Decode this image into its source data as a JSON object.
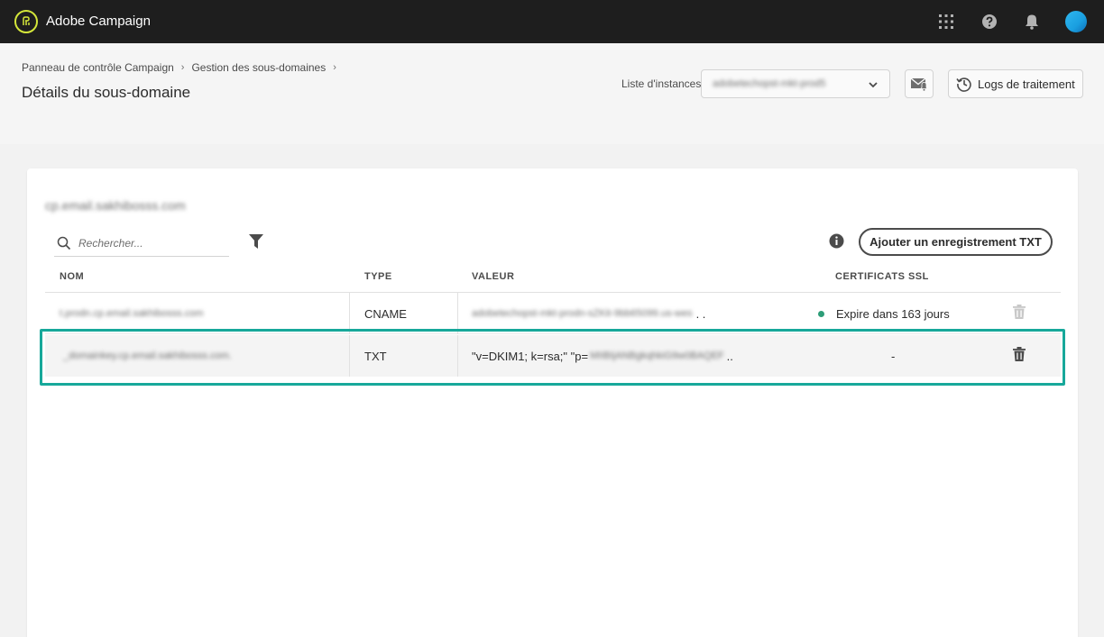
{
  "app": {
    "title": "Adobe Campaign"
  },
  "topbar": {
    "icons": [
      "apps-grid-icon",
      "help-icon",
      "bell-icon",
      "user-avatar"
    ]
  },
  "breadcrumb": {
    "items": [
      "Panneau de contrôle Campaign",
      "Gestion des sous-domaines"
    ]
  },
  "page": {
    "title": "Détails du sous-domaine"
  },
  "instances": {
    "label": "Liste d'instances",
    "selected": "adobetechopst-mkt-prod5"
  },
  "toolbar": {
    "logs_label": "Logs de traitement"
  },
  "subdomain": {
    "name": "cp.email.sakhibosss.com"
  },
  "search": {
    "placeholder": "Rechercher..."
  },
  "actions": {
    "add_txt_label": "Ajouter un enregistrement TXT"
  },
  "table": {
    "headers": {
      "name": "NOM",
      "type": "TYPE",
      "value": "VALEUR",
      "ssl": "CERTIFICATS SSL"
    },
    "rows": [
      {
        "name": "t.prodn.cp.email.sakhibosss.com",
        "type": "CNAME",
        "value_visible": "",
        "value_hidden": "adobetechopst-mkt-prodn-sZKit-9bb65099.us-wes",
        "value_ellipsis": ". .",
        "ssl": "Expire dans 163 jours",
        "ssl_status_color": "#2d9d78"
      },
      {
        "name": "_domainkey.cp.email.sakhibosss.com.",
        "type": "TXT",
        "value_visible": "\"v=DKIM1; k=rsa;\" \"p=",
        "value_hidden": "MIIBIjANBgkqhkiG9w0BAQEF",
        "value_ellipsis": "..",
        "ssl": "-",
        "ssl_status_color": ""
      }
    ]
  },
  "colors": {
    "topbar": "#1e1e1e",
    "logo_accent": "#d4e63a",
    "highlight": "#17a89a",
    "ssl_ok": "#2d9d78"
  }
}
